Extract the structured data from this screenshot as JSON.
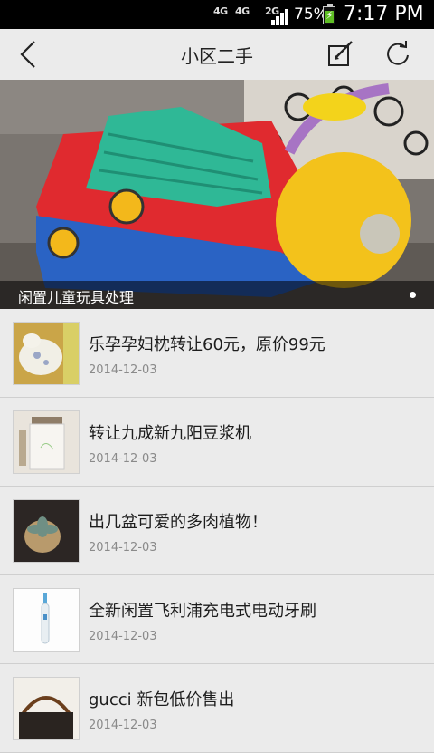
{
  "status_bar": {
    "network1": "4G",
    "network2": "4G",
    "network3": "2G",
    "battery": "75%",
    "time": "7:17 PM"
  },
  "header": {
    "title": "小区二手",
    "icons": [
      "back-arrow-icon",
      "edit-icon",
      "refresh-icon"
    ]
  },
  "banner": {
    "caption": "闲置儿童玩具处理",
    "page_indicator": {
      "current": 1,
      "total": 1
    }
  },
  "items": [
    {
      "title": "乐孕孕妇枕转让60元，原价99元",
      "date": "2014-12-03"
    },
    {
      "title": "转让九成新九阳豆浆机",
      "date": "2014-12-03"
    },
    {
      "title": "出几盆可爱的多肉植物！",
      "date": "2014-12-03"
    },
    {
      "title": "全新闲置飞利浦充电式电动牙刷",
      "date": "2014-12-03"
    },
    {
      "title": "gucci 新包低价售出",
      "date": "2014-12-03"
    }
  ],
  "colors": {
    "background": "#ebebeb",
    "status_bar": "#000000",
    "battery_fill": "#5fbe24",
    "divider": "#cfcfcf",
    "date_text": "#8a8a8a"
  }
}
